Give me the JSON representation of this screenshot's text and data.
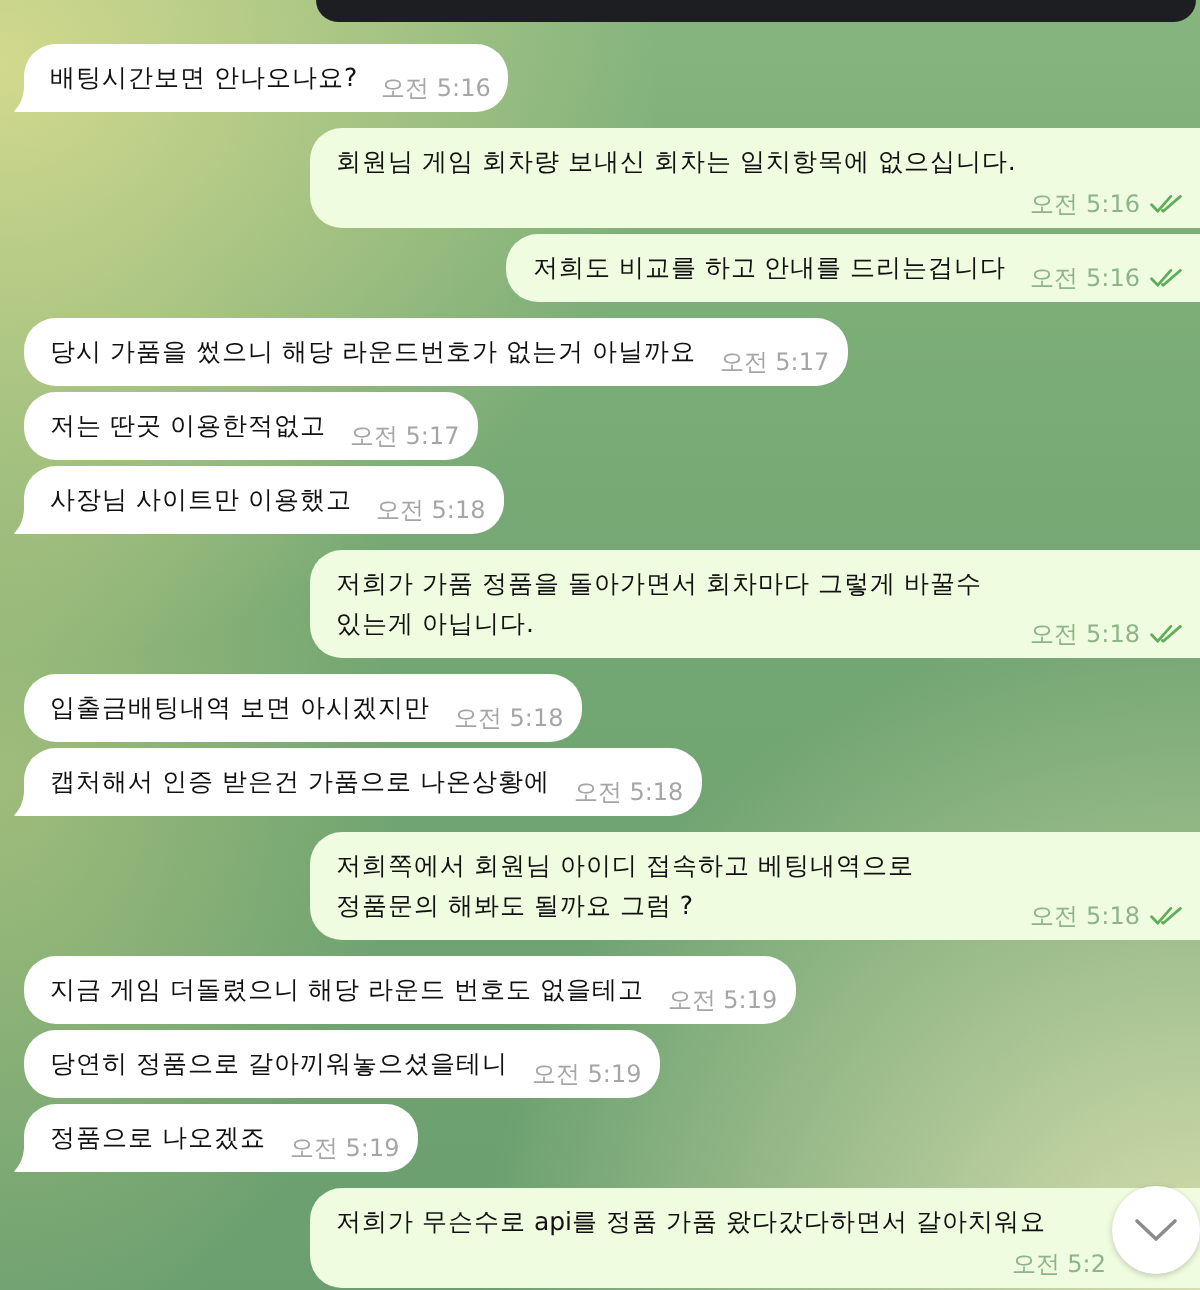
{
  "chat": {
    "groups": [
      {
        "outgoing": true,
        "messages": [
          {
            "kind": "image"
          }
        ]
      },
      {
        "outgoing": false,
        "messages": [
          {
            "kind": "text",
            "text": "배팅시간보면 안나오나요?",
            "time": "오전 5:16"
          }
        ]
      },
      {
        "outgoing": true,
        "messages": [
          {
            "kind": "text",
            "text": "회원님 게임 회차량 보내신 회차는 일치항목에 없으십니다.",
            "time": "오전 5:16",
            "read": true
          },
          {
            "kind": "text",
            "text": "저희도 비교를 하고 안내를 드리는겁니다",
            "time": "오전 5:16",
            "read": true
          }
        ]
      },
      {
        "outgoing": false,
        "messages": [
          {
            "kind": "text",
            "text": "당시 가품을 썼으니 해당 라운드번호가 없는거 아닐까요",
            "time": "오전 5:17"
          },
          {
            "kind": "text",
            "text": "저는 딴곳 이용한적없고",
            "time": "오전 5:17"
          },
          {
            "kind": "text",
            "text": "사장님 사이트만 이용했고",
            "time": "오전 5:18"
          }
        ]
      },
      {
        "outgoing": true,
        "messages": [
          {
            "kind": "text",
            "text": "저희가 가품 정품을 돌아가면서 회차마다 그렇게 바꿀수 있는게 아닙니다.",
            "time": "오전 5:18",
            "read": true
          }
        ]
      },
      {
        "outgoing": false,
        "messages": [
          {
            "kind": "text",
            "text": "입출금배팅내역 보면 아시겠지만",
            "time": "오전 5:18"
          },
          {
            "kind": "text",
            "text": "캡처해서 인증 받은건 가품으로 나온상황에",
            "time": "오전 5:18"
          }
        ]
      },
      {
        "outgoing": true,
        "messages": [
          {
            "kind": "text",
            "text": "저희쪽에서 회원님 아이디 접속하고 베팅내역으로 정품문의 해봐도 될까요 그럼 ?",
            "time": "오전 5:18",
            "read": true
          }
        ]
      },
      {
        "outgoing": false,
        "messages": [
          {
            "kind": "text",
            "text": "지금 게임 더돌렸으니 해당 라운드 번호도 없을테고",
            "time": "오전 5:19"
          },
          {
            "kind": "text",
            "text": "당연히 정품으로 갈아끼워놓으셨을테니",
            "time": "오전 5:19"
          },
          {
            "kind": "text",
            "text": "정품으로 나오겠죠",
            "time": "오전 5:19"
          }
        ]
      },
      {
        "outgoing": true,
        "messages": [
          {
            "kind": "text",
            "text": "저희가 무슨수로 api를 정품 가품 왔다갔다하면서 갈아치워요",
            "time": "오전 5:2"
          }
        ]
      }
    ]
  }
}
